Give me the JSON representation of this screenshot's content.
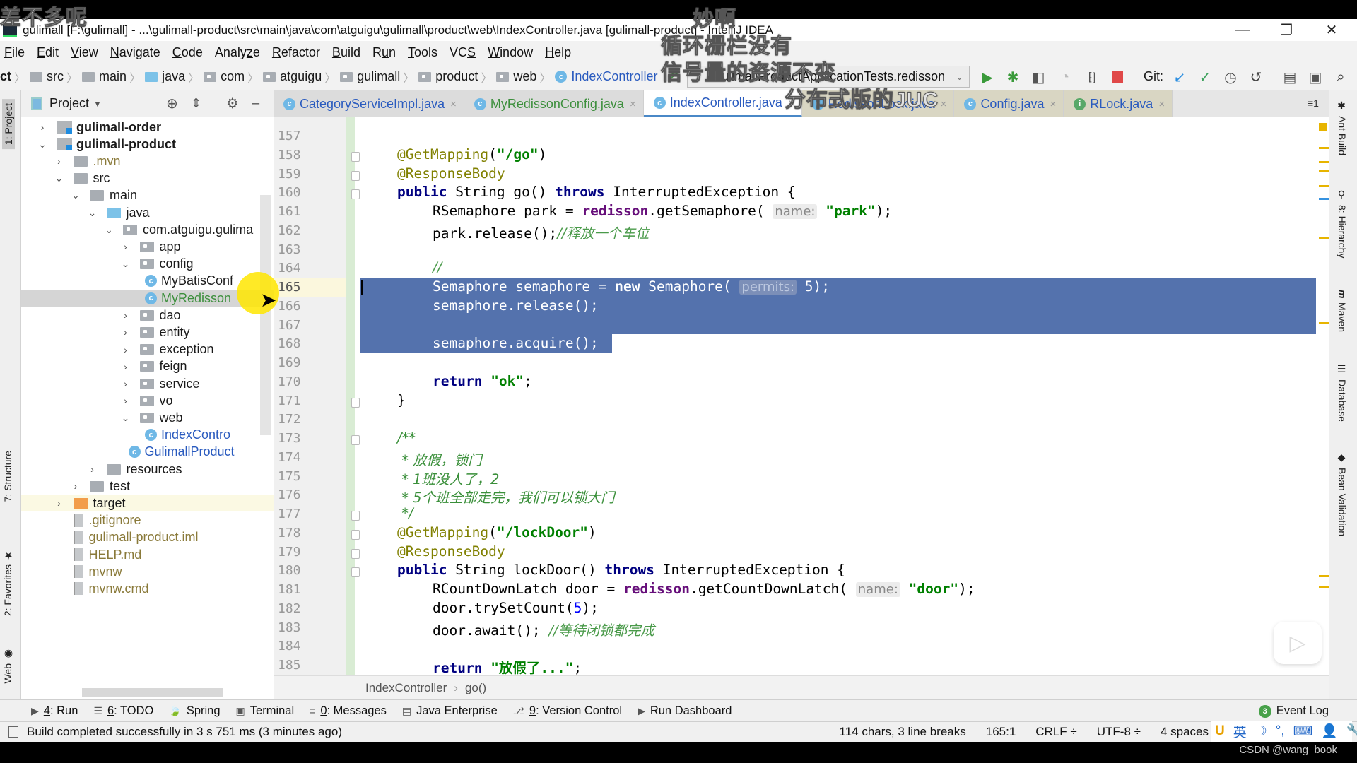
{
  "subtitles": {
    "top_left": "差不多呢",
    "top_center": "妙啊",
    "line1": "循环栅栏没有",
    "line2": "信号量的资源不变",
    "line3": "分布式版的JUC"
  },
  "window": {
    "title": "gulimall [F:\\gulimall] - ...\\gulimall-product\\src\\main\\java\\com\\atguigu\\gulimall\\product\\web\\IndexController.java [gulimall-product] - IntelliJ IDEA",
    "minimize": "—",
    "restore": "❐",
    "close": "✕"
  },
  "menu": [
    {
      "pre": "",
      "u": "F",
      "post": "ile"
    },
    {
      "pre": "",
      "u": "E",
      "post": "dit"
    },
    {
      "pre": "",
      "u": "V",
      "post": "iew"
    },
    {
      "pre": "",
      "u": "N",
      "post": "avigate"
    },
    {
      "pre": "",
      "u": "C",
      "post": "ode"
    },
    {
      "pre": "Analy",
      "u": "z",
      "post": "e"
    },
    {
      "pre": "",
      "u": "R",
      "post": "efactor"
    },
    {
      "pre": "",
      "u": "B",
      "post": "uild"
    },
    {
      "pre": "R",
      "u": "u",
      "post": "n"
    },
    {
      "pre": "",
      "u": "T",
      "post": "ools"
    },
    {
      "pre": "VC",
      "u": "S",
      "post": ""
    },
    {
      "pre": "",
      "u": "W",
      "post": "indow"
    },
    {
      "pre": "",
      "u": "H",
      "post": "elp"
    }
  ],
  "breadcrumb": {
    "items": [
      "ct",
      "src",
      "main",
      "java",
      "com",
      "atguigu",
      "gulimall",
      "product",
      "web",
      "IndexController"
    ]
  },
  "run_config": {
    "selected": "GulimallProductApplicationTests.redisson"
  },
  "toolbar": {
    "git_label": "Git:"
  },
  "project_panel": {
    "title": "Project",
    "tree": [
      {
        "label": "gulimall-order",
        "depth": 0,
        "arrow": "›",
        "type": "module",
        "bold": true
      },
      {
        "label": "gulimall-product",
        "depth": 0,
        "arrow": "⌄",
        "type": "module",
        "bold": true
      },
      {
        "label": ".mvn",
        "depth": 1,
        "arrow": "›",
        "type": "folder",
        "color": "#8a7a3a"
      },
      {
        "label": "src",
        "depth": 1,
        "arrow": "⌄",
        "type": "folder"
      },
      {
        "label": "main",
        "depth": 2,
        "arrow": "⌄",
        "type": "folder"
      },
      {
        "label": "java",
        "depth": 3,
        "arrow": "⌄",
        "type": "folder-blue"
      },
      {
        "label": "com.atguigu.gulima",
        "depth": 4,
        "arrow": "⌄",
        "type": "package"
      },
      {
        "label": "app",
        "depth": 5,
        "arrow": "›",
        "type": "package"
      },
      {
        "label": "config",
        "depth": 5,
        "arrow": "⌄",
        "type": "package"
      },
      {
        "label": "MyBatisConf",
        "depth": 6,
        "arrow": "",
        "type": "class"
      },
      {
        "label": "MyRedisson",
        "depth": 6,
        "arrow": "",
        "type": "class",
        "color": "#3d8f3d",
        "selected": true
      },
      {
        "label": "dao",
        "depth": 5,
        "arrow": "›",
        "type": "package"
      },
      {
        "label": "entity",
        "depth": 5,
        "arrow": "›",
        "type": "package"
      },
      {
        "label": "exception",
        "depth": 5,
        "arrow": "›",
        "type": "package"
      },
      {
        "label": "feign",
        "depth": 5,
        "arrow": "›",
        "type": "package"
      },
      {
        "label": "service",
        "depth": 5,
        "arrow": "›",
        "type": "package"
      },
      {
        "label": "vo",
        "depth": 5,
        "arrow": "›",
        "type": "package"
      },
      {
        "label": "web",
        "depth": 5,
        "arrow": "⌄",
        "type": "package"
      },
      {
        "label": "IndexContro",
        "depth": 6,
        "arrow": "",
        "type": "class",
        "color": "#2a5bbf"
      },
      {
        "label": "GulimallProduct",
        "depth": 5,
        "arrow": "",
        "type": "springclass",
        "color": "#2a5bbf"
      },
      {
        "label": "resources",
        "depth": 3,
        "arrow": "›",
        "type": "folder"
      },
      {
        "label": "test",
        "depth": 2,
        "arrow": "›",
        "type": "folder"
      },
      {
        "label": "target",
        "depth": 1,
        "arrow": "›",
        "type": "folder-orange",
        "highlighted": true
      },
      {
        "label": ".gitignore",
        "depth": 1,
        "arrow": "",
        "type": "file",
        "color": "#8a7a3a"
      },
      {
        "label": "gulimall-product.iml",
        "depth": 1,
        "arrow": "",
        "type": "file",
        "color": "#8a7a3a"
      },
      {
        "label": "HELP.md",
        "depth": 1,
        "arrow": "",
        "type": "file",
        "color": "#8a7a3a"
      },
      {
        "label": "mvnw",
        "depth": 1,
        "arrow": "",
        "type": "file",
        "color": "#8a7a3a"
      },
      {
        "label": "mvnw.cmd",
        "depth": 1,
        "arrow": "",
        "type": "file",
        "color": "#8a7a3a"
      }
    ]
  },
  "left_strip": [
    "1: Project",
    "7: Structure",
    "2: Favorites",
    "Web"
  ],
  "right_strip": [
    "Ant Build",
    "8: Hierarchy",
    "Maven",
    "Database",
    "Bean Validation"
  ],
  "tabs": [
    {
      "label": "CategoryServiceImpl.java",
      "color": "#2a5bbf",
      "icon": "C"
    },
    {
      "label": "MyRedissonConfig.java",
      "color": "#3d8f3d",
      "icon": "C"
    },
    {
      "label": "IndexController.java",
      "color": "#2a5bbf",
      "icon": "C",
      "active": true
    },
    {
      "label": "RedissonLock.java",
      "color": "#2a5bbf",
      "icon": "C",
      "modified": true
    },
    {
      "label": "Config.java",
      "color": "#2a5bbf",
      "icon": "C",
      "modified": true
    },
    {
      "label": "RLock.java",
      "color": "#2a5bbf",
      "icon": "I",
      "modified": true
    }
  ],
  "tab_overflow": "≡1",
  "editor": {
    "current_line": 165,
    "lines": [
      {
        "n": 157,
        "segs": []
      },
      {
        "n": 158,
        "segs": [
          {
            "t": "@GetMapping",
            "c": "ann"
          },
          {
            "t": "("
          },
          {
            "t": "\"/go\"",
            "c": "str"
          },
          {
            "t": ")"
          }
        ],
        "indent": 1
      },
      {
        "n": 159,
        "segs": [
          {
            "t": "@ResponseBody",
            "c": "ann"
          }
        ],
        "indent": 1
      },
      {
        "n": 160,
        "segs": [
          {
            "t": "public ",
            "c": "kw"
          },
          {
            "t": "String go() "
          },
          {
            "t": "throws ",
            "c": "kw"
          },
          {
            "t": "InterruptedException {"
          }
        ],
        "indent": 1
      },
      {
        "n": 161,
        "segs": [
          {
            "t": "RSemaphore park = "
          },
          {
            "t": "redisson",
            "c": "fld"
          },
          {
            "t": ".getSemaphore( "
          },
          {
            "t": "name:",
            "c": "hint"
          },
          {
            "t": " "
          },
          {
            "t": "\"park\"",
            "c": "str"
          },
          {
            "t": ");"
          }
        ],
        "indent": 2
      },
      {
        "n": 162,
        "segs": [
          {
            "t": "park.release();"
          },
          {
            "t": "//释放一个车位",
            "c": "cmt"
          }
        ],
        "indent": 2
      },
      {
        "n": 163,
        "segs": []
      },
      {
        "n": 164,
        "segs": [
          {
            "t": "//",
            "c": "cmt"
          }
        ],
        "indent": 2
      },
      {
        "n": 165,
        "segs": [
          {
            "t": "Semaphore semaphore = "
          },
          {
            "t": "new ",
            "c": "kw"
          },
          {
            "t": "Semaphore( "
          },
          {
            "t": "permits:",
            "c": "sel-hint"
          },
          {
            "t": " 5);"
          }
        ],
        "indent": 2,
        "selected": true
      },
      {
        "n": 166,
        "segs": [
          {
            "t": "semaphore.release();"
          }
        ],
        "indent": 2,
        "selected": true
      },
      {
        "n": 167,
        "segs": [],
        "selected": true
      },
      {
        "n": 168,
        "segs": [
          {
            "t": "semaphore.acquire();"
          }
        ],
        "indent": 2,
        "selected": true
      },
      {
        "n": 169,
        "segs": []
      },
      {
        "n": 170,
        "segs": [
          {
            "t": "return ",
            "c": "kw"
          },
          {
            "t": "\"ok\"",
            "c": "str"
          },
          {
            "t": ";"
          }
        ],
        "indent": 2
      },
      {
        "n": 171,
        "segs": [
          {
            "t": "}"
          }
        ],
        "indent": 1
      },
      {
        "n": 172,
        "segs": []
      },
      {
        "n": 173,
        "segs": [
          {
            "t": "/**",
            "c": "doc"
          }
        ],
        "indent": 1
      },
      {
        "n": 174,
        "segs": [
          {
            "t": " * 放假，锁门",
            "c": "doc"
          }
        ],
        "indent": 1
      },
      {
        "n": 175,
        "segs": [
          {
            "t": " * 1班没人了，2",
            "c": "doc"
          }
        ],
        "indent": 1
      },
      {
        "n": 176,
        "segs": [
          {
            "t": " * 5个班全部走完，我们可以锁大门",
            "c": "doc"
          }
        ],
        "indent": 1
      },
      {
        "n": 177,
        "segs": [
          {
            "t": " */",
            "c": "doc"
          }
        ],
        "indent": 1
      },
      {
        "n": 178,
        "segs": [
          {
            "t": "@GetMapping",
            "c": "ann"
          },
          {
            "t": "("
          },
          {
            "t": "\"/lockDoor\"",
            "c": "str"
          },
          {
            "t": ")"
          }
        ],
        "indent": 1
      },
      {
        "n": 179,
        "segs": [
          {
            "t": "@ResponseBody",
            "c": "ann"
          }
        ],
        "indent": 1
      },
      {
        "n": 180,
        "segs": [
          {
            "t": "public ",
            "c": "kw"
          },
          {
            "t": "String lockDoor() "
          },
          {
            "t": "throws ",
            "c": "kw"
          },
          {
            "t": "InterruptedException {"
          }
        ],
        "indent": 1
      },
      {
        "n": 181,
        "segs": [
          {
            "t": "RCountDownLatch door = "
          },
          {
            "t": "redisson",
            "c": "fld"
          },
          {
            "t": ".getCountDownLatch( "
          },
          {
            "t": "name:",
            "c": "hint"
          },
          {
            "t": " "
          },
          {
            "t": "\"door\"",
            "c": "str"
          },
          {
            "t": ");"
          }
        ],
        "indent": 2
      },
      {
        "n": 182,
        "segs": [
          {
            "t": "door.trySetCount("
          },
          {
            "t": "5",
            "c": "num"
          },
          {
            "t": ");"
          }
        ],
        "indent": 2
      },
      {
        "n": 183,
        "segs": [
          {
            "t": "door.await(); "
          },
          {
            "t": "//等待闭锁都完成",
            "c": "cmt"
          }
        ],
        "indent": 2
      },
      {
        "n": 184,
        "segs": []
      },
      {
        "n": 185,
        "segs": [
          {
            "t": "return ",
            "c": "kw"
          },
          {
            "t": "\"放假了...\"",
            "c": "str"
          },
          {
            "t": ";"
          }
        ],
        "indent": 2
      }
    ]
  },
  "editor_breadcrumb": [
    "IndexController",
    "go()"
  ],
  "tool_windows": [
    {
      "icon": "▶",
      "pre": "",
      "u": "4",
      "post": ": Run"
    },
    {
      "icon": "☰",
      "pre": "",
      "u": "6",
      "post": ": TODO"
    },
    {
      "icon": "🍃",
      "pre": "",
      "u": "",
      "post": "Spring"
    },
    {
      "icon": "▣",
      "pre": "",
      "u": "",
      "post": "Terminal"
    },
    {
      "icon": "≡",
      "pre": "",
      "u": "0",
      "post": ": Messages"
    },
    {
      "icon": "▤",
      "pre": "",
      "u": "",
      "post": "Java Enterprise"
    },
    {
      "icon": "⎇",
      "pre": "",
      "u": "9",
      "post": ": Version Control"
    },
    {
      "icon": "▶",
      "pre": "",
      "u": "",
      "post": "Run Dashboard"
    }
  ],
  "event_log": {
    "count": "3",
    "label": "Event Log"
  },
  "status": {
    "message": "Build completed successfully in 3 s 751 ms (3 minutes ago)",
    "selection_info": "114 chars, 3 line breaks",
    "position": "165:1",
    "line_sep": "CRLF ÷",
    "encoding": "UTF-8 ÷",
    "indent": "4 spaces"
  },
  "ime": [
    "U",
    "英",
    "☽",
    "°,",
    "⌨",
    "👤",
    "🔧"
  ],
  "watermark": "CSDN @wang_book"
}
